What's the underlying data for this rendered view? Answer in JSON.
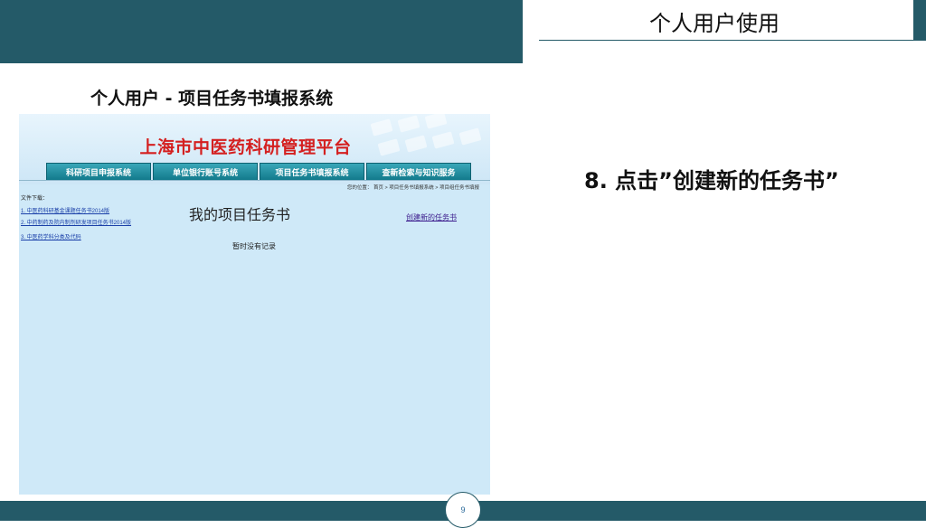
{
  "slide": {
    "header": "个人用户使用",
    "title": "个人用户 - 项目任务书填报系统",
    "step": "8. 点击”创建新的任务书”",
    "page_number": "9"
  },
  "screenshot": {
    "platform_title": "上海市中医药科研管理平台",
    "nav": [
      {
        "label": "科研项目申报系统"
      },
      {
        "label": "单位银行账号系统"
      },
      {
        "label": "项目任务书填报系统"
      },
      {
        "label": "查新检索与知识服务"
      }
    ],
    "breadcrumb": "您的位置： 首页 > 项目任务书填报系统 > 项目组任务书填报",
    "downloads_label": "文件下载：",
    "downloads": [
      {
        "label": "1. 中医药科研基金课题任务书2014版"
      },
      {
        "label": "2. 中药制药及院内制剂研发项目任务书2014版"
      },
      {
        "label": "3. 中医药学科分类及代码"
      }
    ],
    "heading": "我的项目任务书",
    "create_link": "创建新的任务书",
    "empty_text": "暂时没有记录"
  },
  "colors": {
    "theme": "#245a68",
    "platform_title": "#d42020",
    "nav_button": "#1a8a9c",
    "panel_bg": "#cfe9f8"
  }
}
